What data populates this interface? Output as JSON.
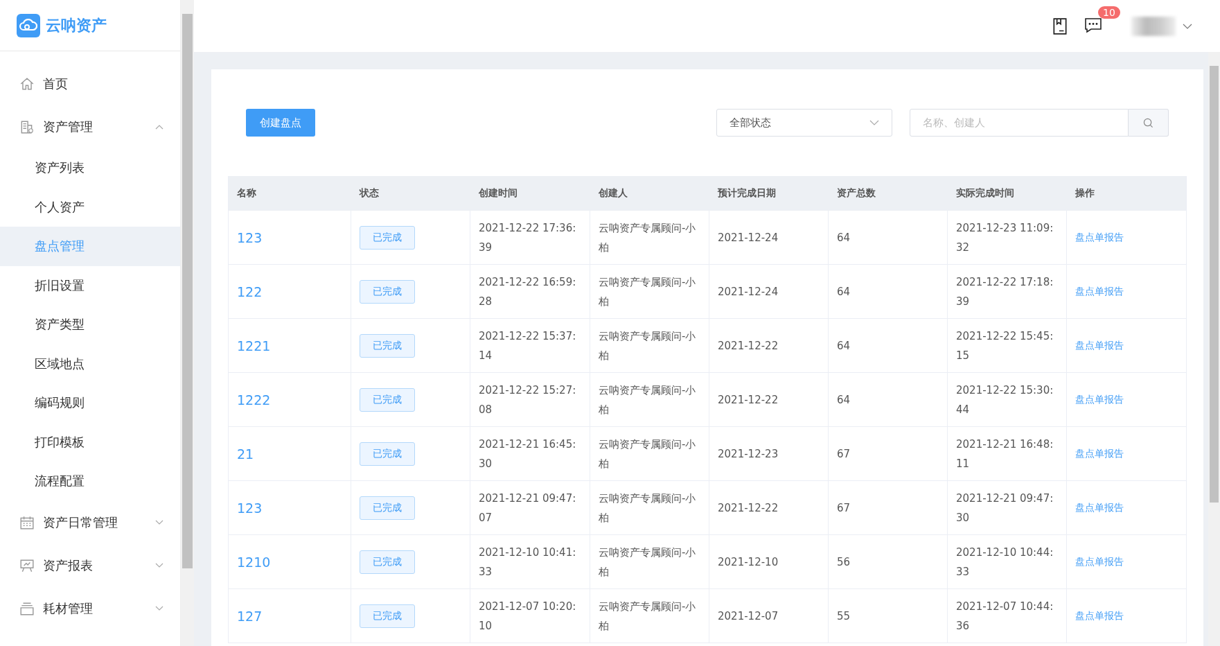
{
  "brand": {
    "name": "云呐资产"
  },
  "header": {
    "message_badge": "10"
  },
  "sidebar": {
    "items": [
      {
        "label": "首页",
        "kind": "home",
        "selected": false
      },
      {
        "label": "资产管理",
        "kind": "building",
        "selected": false,
        "expanded": true,
        "children": [
          {
            "label": "资产列表",
            "selected": false
          },
          {
            "label": "个人资产",
            "selected": false
          },
          {
            "label": "盘点管理",
            "selected": true
          },
          {
            "label": "折旧设置",
            "selected": false
          },
          {
            "label": "资产类型",
            "selected": false
          },
          {
            "label": "区域地点",
            "selected": false
          },
          {
            "label": "编码规则",
            "selected": false
          },
          {
            "label": "打印模板",
            "selected": false
          },
          {
            "label": "流程配置",
            "selected": false
          }
        ]
      },
      {
        "label": "资产日常管理",
        "kind": "calendar",
        "selected": false,
        "expanded": false
      },
      {
        "label": "资产报表",
        "kind": "board",
        "selected": false,
        "expanded": false
      },
      {
        "label": "耗材管理",
        "kind": "tray",
        "selected": false,
        "expanded": false
      }
    ]
  },
  "toolbar": {
    "create_button": "创建盘点",
    "status_filter": "全部状态",
    "search": {
      "placeholder": "名称、创建人"
    }
  },
  "table": {
    "columns": [
      "名称",
      "状态",
      "创建时间",
      "创建人",
      "预计完成日期",
      "资产总数",
      "实际完成时间",
      "操作"
    ],
    "rows": [
      {
        "name": "123",
        "status": "已完成",
        "created": "2021-12-22 17:36:39",
        "creator": "云呐资产专属顾问-小柏",
        "due": "2021-12-24",
        "total": "64",
        "finished": "2021-12-23 11:09:32",
        "action": "盘点单报告"
      },
      {
        "name": "122",
        "status": "已完成",
        "created": "2021-12-22 16:59:28",
        "creator": "云呐资产专属顾问-小柏",
        "due": "2021-12-24",
        "total": "64",
        "finished": "2021-12-22 17:18:39",
        "action": "盘点单报告"
      },
      {
        "name": "1221",
        "status": "已完成",
        "created": "2021-12-22 15:37:14",
        "creator": "云呐资产专属顾问-小柏",
        "due": "2021-12-22",
        "total": "64",
        "finished": "2021-12-22 15:45:15",
        "action": "盘点单报告"
      },
      {
        "name": "1222",
        "status": "已完成",
        "created": "2021-12-22 15:27:08",
        "creator": "云呐资产专属顾问-小柏",
        "due": "2021-12-22",
        "total": "64",
        "finished": "2021-12-22 15:30:44",
        "action": "盘点单报告"
      },
      {
        "name": "21",
        "status": "已完成",
        "created": "2021-12-21 16:45:30",
        "creator": "云呐资产专属顾问-小柏",
        "due": "2021-12-23",
        "total": "67",
        "finished": "2021-12-21 16:48:11",
        "action": "盘点单报告"
      },
      {
        "name": "123",
        "status": "已完成",
        "created": "2021-12-21 09:47:07",
        "creator": "云呐资产专属顾问-小柏",
        "due": "2021-12-22",
        "total": "67",
        "finished": "2021-12-21 09:47:30",
        "action": "盘点单报告"
      },
      {
        "name": "1210",
        "status": "已完成",
        "created": "2021-12-10 10:41:33",
        "creator": "云呐资产专属顾问-小柏",
        "due": "2021-12-10",
        "total": "56",
        "finished": "2021-12-10 10:44:33",
        "action": "盘点单报告"
      },
      {
        "name": "127",
        "status": "已完成",
        "created": "2021-12-07 10:20:10",
        "creator": "云呐资产专属顾问-小柏",
        "due": "2021-12-07",
        "total": "55",
        "finished": "2021-12-07 10:44:36",
        "action": "盘点单报告"
      }
    ]
  }
}
